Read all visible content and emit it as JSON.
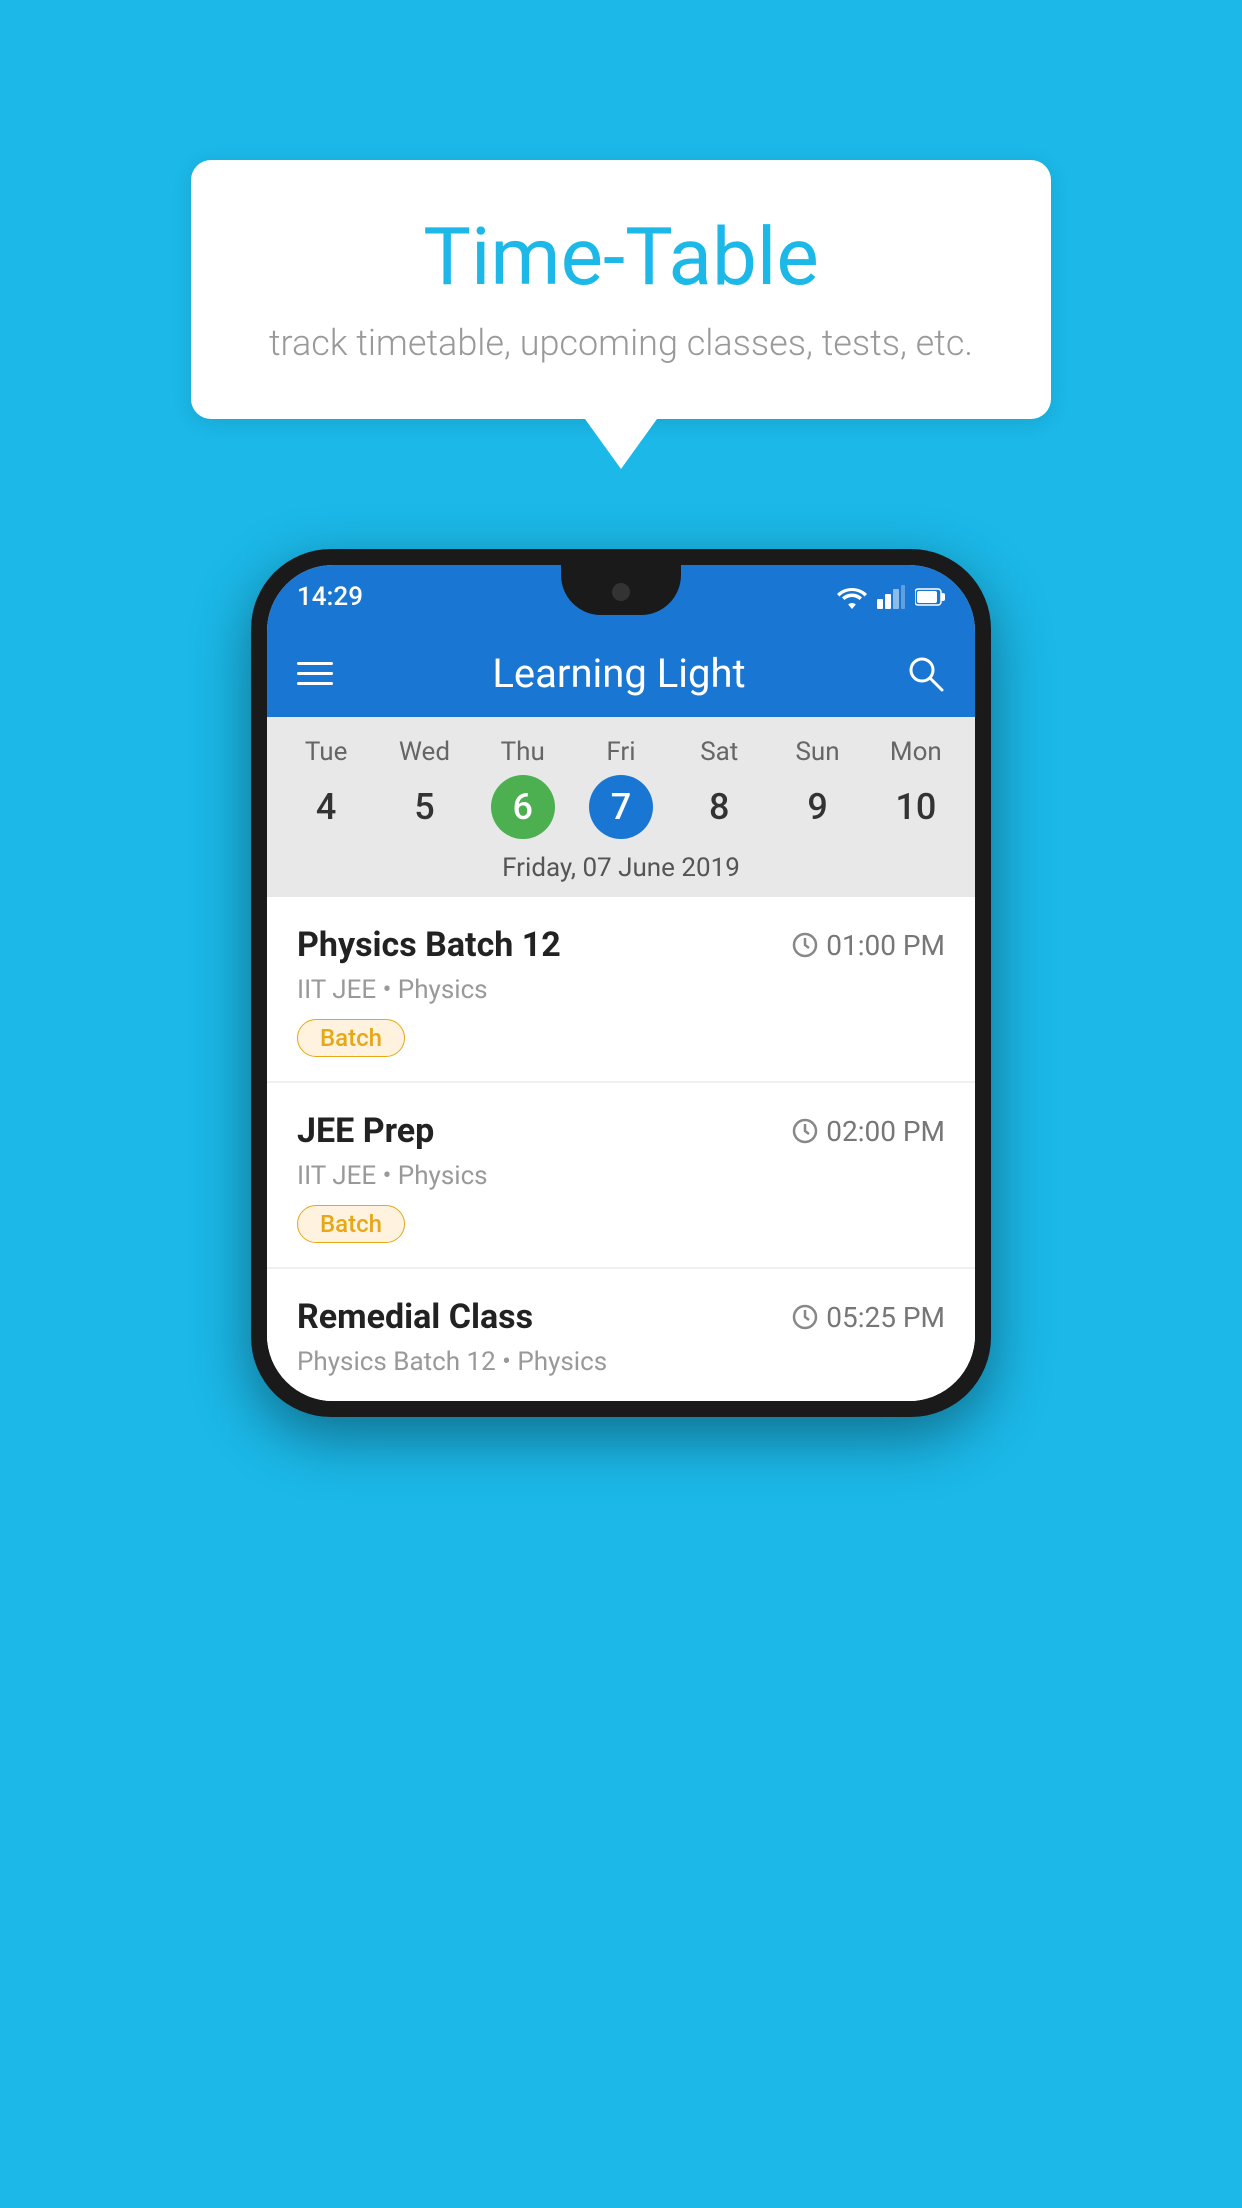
{
  "background_color": "#1BB8E8",
  "tooltip": {
    "title": "Time-Table",
    "subtitle": "track timetable, upcoming classes, tests, etc."
  },
  "phone": {
    "status_bar": {
      "time": "14:29",
      "icons": [
        "wifi",
        "signal",
        "battery"
      ]
    },
    "app_bar": {
      "title": "Learning Light",
      "menu_icon": "hamburger",
      "search_icon": "search"
    },
    "calendar": {
      "days": [
        {
          "name": "Tue",
          "num": "4",
          "state": "normal"
        },
        {
          "name": "Wed",
          "num": "5",
          "state": "normal"
        },
        {
          "name": "Thu",
          "num": "6",
          "state": "today"
        },
        {
          "name": "Fri",
          "num": "7",
          "state": "selected"
        },
        {
          "name": "Sat",
          "num": "8",
          "state": "normal"
        },
        {
          "name": "Sun",
          "num": "9",
          "state": "normal"
        },
        {
          "name": "Mon",
          "num": "10",
          "state": "normal"
        }
      ],
      "selected_date_label": "Friday, 07 June 2019"
    },
    "events": [
      {
        "title": "Physics Batch 12",
        "time": "01:00 PM",
        "subtitle": "IIT JEE • Physics",
        "badge": "Batch"
      },
      {
        "title": "JEE Prep",
        "time": "02:00 PM",
        "subtitle": "IIT JEE • Physics",
        "badge": "Batch"
      },
      {
        "title": "Remedial Class",
        "time": "05:25 PM",
        "subtitle": "Physics Batch 12 • Physics",
        "badge": ""
      }
    ]
  }
}
